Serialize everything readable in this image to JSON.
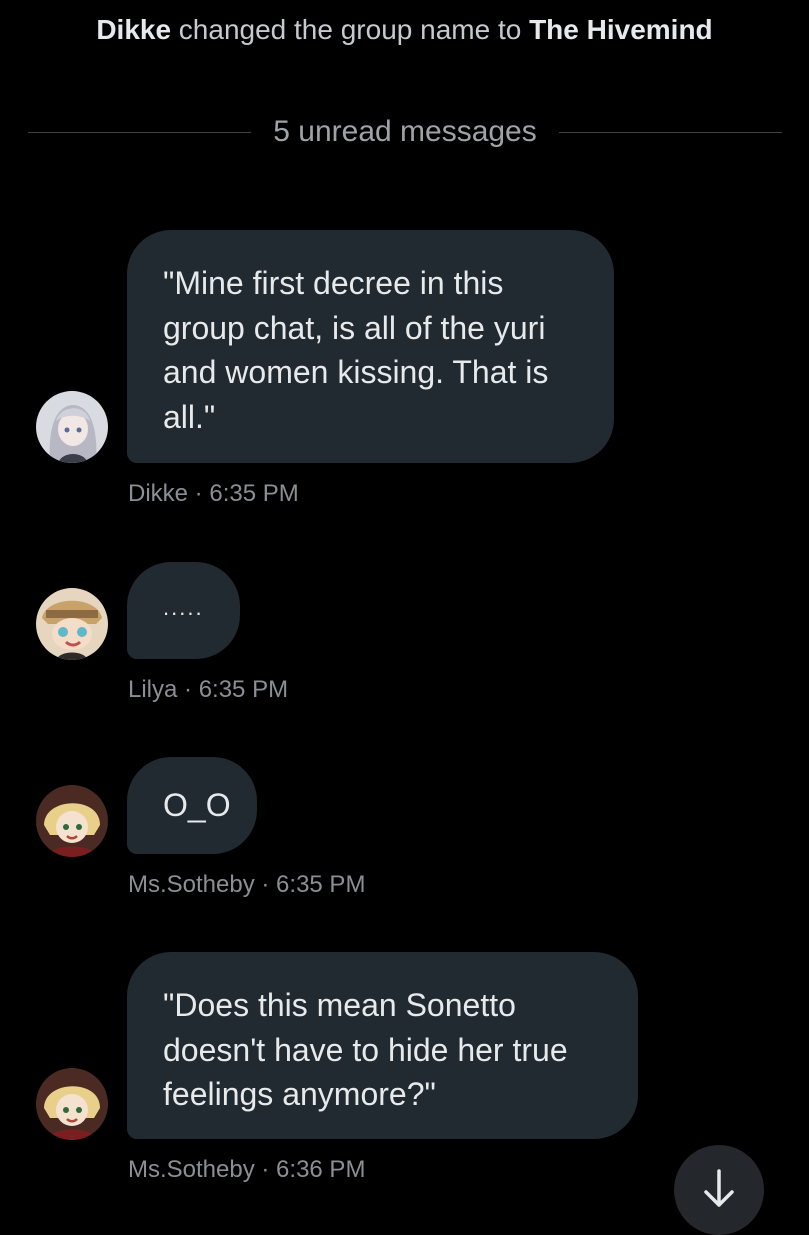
{
  "system_message": {
    "actor": "Dikke",
    "action": " changed the group name to ",
    "group_name": "The Hivemind"
  },
  "unread_divider": "5 unread messages",
  "messages": [
    {
      "text": "\"Mine first decree in this\ngroup chat, is all of the yuri\nand women kissing. That is\nall.\"",
      "meta": "Dikke · 6:35 PM",
      "avatar": "avatar-dikke"
    },
    {
      "text": ".....",
      "meta": "Lilya · 6:35 PM",
      "avatar": "avatar-lilya"
    },
    {
      "text": "O_O",
      "meta": "Ms.Sotheby · 6:35 PM",
      "avatar": "avatar-ms-sotheby"
    },
    {
      "text": "\"Does this mean Sonetto\ndoesn't have to hide her true\nfeelings anymore?\"",
      "meta": "Ms.Sotheby · 6:36 PM",
      "avatar": "avatar-ms-sotheby"
    }
  ],
  "scroll_button_icon": "arrow-down-icon",
  "colors": {
    "background": "#000000",
    "bubble": "#212a31",
    "text": "#e7e9ea",
    "meta": "#8a8f94"
  }
}
